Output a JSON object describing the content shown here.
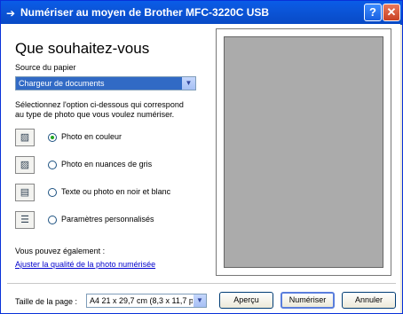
{
  "window": {
    "title": "Numériser au moyen de Brother MFC-3220C USB"
  },
  "titlebar_buttons": {
    "help": "?",
    "close": "✕"
  },
  "main": {
    "heading": "Que souhaitez-vous",
    "paper_source_label": "Source du papier",
    "paper_source_value": "Chargeur de documents",
    "instruction_line1": "Sélectionnez l'option ci-dessous qui correspond",
    "instruction_line2": "au type de photo que vous voulez numériser.",
    "options": [
      {
        "label": "Photo en couleur",
        "icon": "color-photo-icon",
        "checked": true
      },
      {
        "label": "Photo en nuances de gris",
        "icon": "grayscale-photo-icon",
        "checked": false
      },
      {
        "label": "Texte ou photo en noir et blanc",
        "icon": "text-bw-icon",
        "checked": false
      },
      {
        "label": "Paramètres personnalisés",
        "icon": "custom-settings-icon",
        "checked": false
      }
    ],
    "also_label": "Vous pouvez également :",
    "adjust_link": "Ajuster la qualité de la photo numérisée"
  },
  "footer": {
    "page_size_label": "Taille de la page :",
    "page_size_value": "A4 21 x 29,7 cm (8,3 x 11,7 po)",
    "preview_button": "Aperçu",
    "scan_button": "Numériser",
    "cancel_button": "Annuler"
  },
  "colors": {
    "titlebar": "#0a5ce8",
    "selection": "#316ac5",
    "preview_area": "#ababab"
  }
}
